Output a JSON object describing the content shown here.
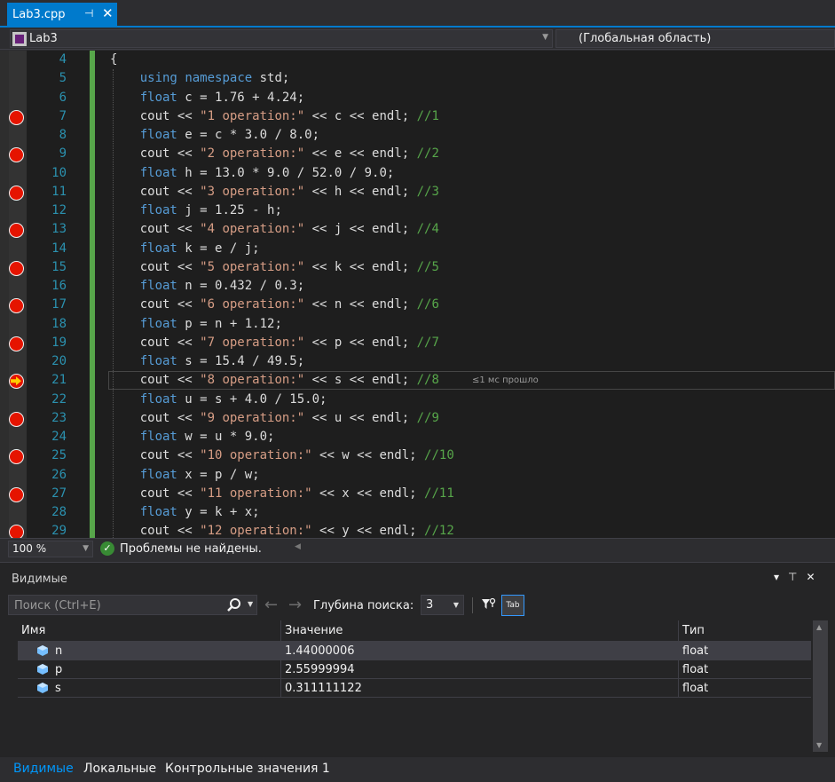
{
  "tab": {
    "title": "Lab3.cpp",
    "pin_icon": "pin-icon",
    "close_icon": "close-icon"
  },
  "navbar": {
    "project": "Lab3",
    "scope": "(Глобальная область)"
  },
  "editor": {
    "lines": [
      {
        "num": "4",
        "text": "{",
        "bp": false
      },
      {
        "num": "5",
        "text": "    using namespace std;",
        "bp": false
      },
      {
        "num": "6",
        "text": "    float c = 1.76 + 4.24;",
        "bp": false
      },
      {
        "num": "7",
        "text": "    cout << \"1 operation:\" << c << endl; //1",
        "bp": true
      },
      {
        "num": "8",
        "text": "    float e = c * 3.0 / 8.0;",
        "bp": false
      },
      {
        "num": "9",
        "text": "    cout << \"2 operation:\" << e << endl; //2",
        "bp": true
      },
      {
        "num": "10",
        "text": "    float h = 13.0 * 9.0 / 52.0 / 9.0;",
        "bp": false
      },
      {
        "num": "11",
        "text": "    cout << \"3 operation:\" << h << endl; //3",
        "bp": true
      },
      {
        "num": "12",
        "text": "    float j = 1.25 - h;",
        "bp": false
      },
      {
        "num": "13",
        "text": "    cout << \"4 operation:\" << j << endl; //4",
        "bp": true
      },
      {
        "num": "14",
        "text": "    float k = e / j;",
        "bp": false
      },
      {
        "num": "15",
        "text": "    cout << \"5 operation:\" << k << endl; //5",
        "bp": true
      },
      {
        "num": "16",
        "text": "    float n = 0.432 / 0.3;",
        "bp": false
      },
      {
        "num": "17",
        "text": "    cout << \"6 operation:\" << n << endl; //6",
        "bp": true
      },
      {
        "num": "18",
        "text": "    float p = n + 1.12;",
        "bp": false
      },
      {
        "num": "19",
        "text": "    cout << \"7 operation:\" << p << endl; //7",
        "bp": true
      },
      {
        "num": "20",
        "text": "    float s = 15.4 / 49.5;",
        "bp": false
      },
      {
        "num": "21",
        "text": "    cout << \"8 operation:\" << s << endl; //8",
        "bp": true,
        "current": true
      },
      {
        "num": "22",
        "text": "    float u = s + 4.0 / 15.0;",
        "bp": false
      },
      {
        "num": "23",
        "text": "    cout << \"9 operation:\" << u << endl; //9",
        "bp": true
      },
      {
        "num": "24",
        "text": "    float w = u * 9.0;",
        "bp": false
      },
      {
        "num": "25",
        "text": "    cout << \"10 operation:\" << w << endl; //10",
        "bp": true
      },
      {
        "num": "26",
        "text": "    float x = p / w;",
        "bp": false
      },
      {
        "num": "27",
        "text": "    cout << \"11 operation:\" << x << endl; //11",
        "bp": true
      },
      {
        "num": "28",
        "text": "    float y = k + x;",
        "bp": false
      },
      {
        "num": "29",
        "text": "    cout << \"12 operation:\" << y << endl; //12",
        "bp": true
      }
    ],
    "perf_tip": "≤1 мс прошло"
  },
  "status": {
    "zoom": "100 %",
    "issues": "Проблемы не найдены."
  },
  "autos": {
    "title": "Видимые",
    "search_placeholder": "Поиск (Ctrl+E)",
    "depth_label": "Глубина поиска:",
    "depth_value": "3",
    "columns": {
      "name": "Имя",
      "value": "Значение",
      "type": "Тип"
    },
    "rows": [
      {
        "name": "n",
        "value": "1.44000006",
        "type": "float"
      },
      {
        "name": "p",
        "value": "2.55999994",
        "type": "float"
      },
      {
        "name": "s",
        "value": "0.311111122",
        "type": "float"
      }
    ],
    "tab_button_label": "Tab"
  },
  "bottom_tabs": [
    "Видимые",
    "Локальные",
    "Контрольные значения 1"
  ],
  "colors": {
    "accent": "#007acc",
    "breakpoint": "#e51400",
    "keyword": "#569cd6",
    "string": "#d69d85",
    "comment": "#57a64a"
  }
}
